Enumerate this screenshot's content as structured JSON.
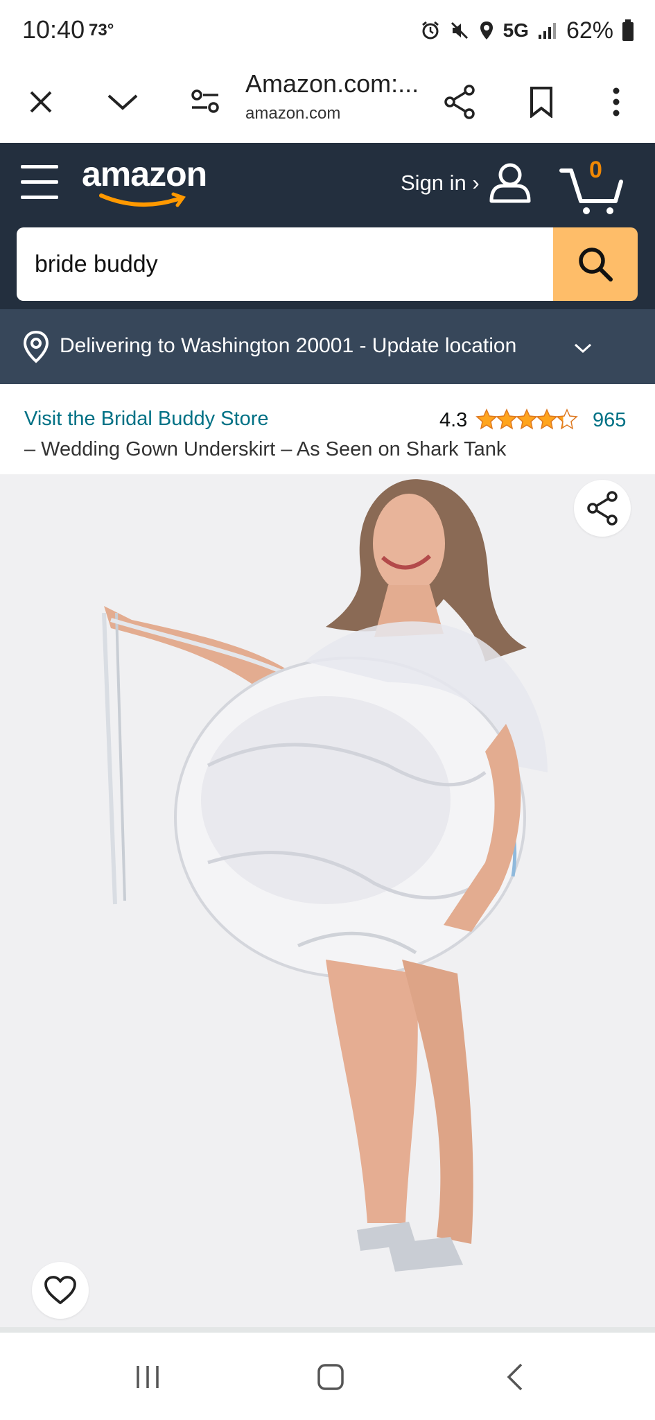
{
  "status_bar": {
    "time": "10:40",
    "temperature": "73°",
    "network": "5G",
    "battery": "62%"
  },
  "browser": {
    "page_title": "Amazon.com:...",
    "domain": "amazon.com"
  },
  "header": {
    "logo": "amazon",
    "sign_in": "Sign in ›",
    "cart_count": "0"
  },
  "search": {
    "query": "bride buddy"
  },
  "delivery": {
    "text": "Delivering to Washington 20001 - Update location"
  },
  "product": {
    "store_link": "Visit the Bridal Buddy Store",
    "rating": "4.3",
    "rating_value": 4.3,
    "review_count": "965",
    "title": "– Wedding Gown Underskirt – As Seen on Shark Tank"
  },
  "colors": {
    "header_bg": "#232f3e",
    "delivery_bg": "#37475a",
    "search_button": "#febd69",
    "link": "#007185",
    "star": "#ffa41c",
    "cart_count": "#f08804"
  }
}
